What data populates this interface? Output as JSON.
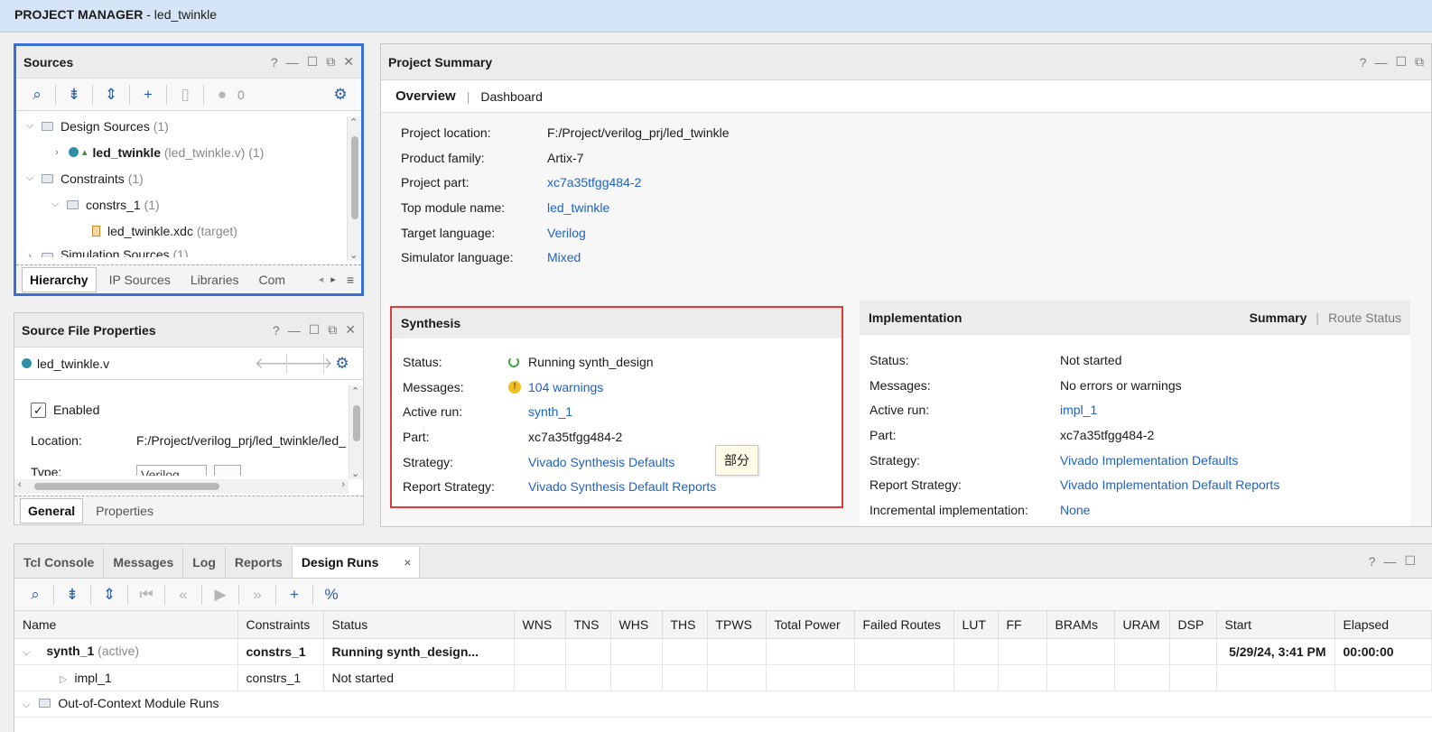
{
  "window": {
    "title_bold": "PROJECT MANAGER",
    "title_rest": " - led_twinkle"
  },
  "sources": {
    "title": "Sources",
    "help": "?",
    "counter": "0",
    "tree": [
      {
        "label": "Design Sources",
        "extra": "(1)"
      },
      {
        "label": "led_twinkle",
        "extra": "(led_twinkle.v) (1)"
      },
      {
        "label": "Constraints",
        "extra": "(1)"
      },
      {
        "label": "constrs_1",
        "extra": "(1)"
      },
      {
        "label": "led_twinkle.xdc",
        "extra": "(target)"
      },
      {
        "label": "Simulation Sources",
        "extra": "(1)"
      }
    ],
    "tabs": [
      "Hierarchy",
      "IP Sources",
      "Libraries",
      "Com"
    ]
  },
  "props": {
    "title": "Source File Properties",
    "file": "led_twinkle.v",
    "enabled_label": "Enabled",
    "location_label": "Location:",
    "location_value": "F:/Project/verilog_prj/led_twinkle/led_",
    "type_label": "Type:",
    "type_value": "Verilog",
    "tabs": [
      "General",
      "Properties"
    ]
  },
  "summary": {
    "title": "Project Summary",
    "tabs": [
      "Overview",
      "Dashboard"
    ],
    "rows": [
      {
        "k": "Project location:",
        "v": "F:/Project/verilog_prj/led_twinkle"
      },
      {
        "k": "Product family:",
        "v": "Artix-7"
      },
      {
        "k": "Project part:",
        "v": "xc7a35tfgg484-2"
      },
      {
        "k": "Top module name:",
        "v": "led_twinkle"
      },
      {
        "k": "Target language:",
        "v": "Verilog"
      },
      {
        "k": "Simulator language:",
        "v": "Mixed"
      }
    ]
  },
  "synthesis": {
    "title": "Synthesis",
    "rows": [
      {
        "k": "Status:",
        "v": "Running synth_design"
      },
      {
        "k": "Messages:",
        "v": "104 warnings"
      },
      {
        "k": "Active run:",
        "v": "synth_1"
      },
      {
        "k": "Part:",
        "v": "xc7a35tfgg484-2"
      },
      {
        "k": "Strategy:",
        "v": "Vivado Synthesis Defaults"
      },
      {
        "k": "Report Strategy:",
        "v": "Vivado Synthesis Default Reports"
      }
    ],
    "tooltip": "部分"
  },
  "implementation": {
    "title": "Implementation",
    "tabs": [
      "Summary",
      "Route Status"
    ],
    "rows": [
      {
        "k": "Status:",
        "v": "Not started"
      },
      {
        "k": "Messages:",
        "v": "No errors or warnings"
      },
      {
        "k": "Active run:",
        "v": "impl_1"
      },
      {
        "k": "Part:",
        "v": "xc7a35tfgg484-2"
      },
      {
        "k": "Strategy:",
        "v": "Vivado Implementation Defaults"
      },
      {
        "k": "Report Strategy:",
        "v": "Vivado Implementation Default Reports"
      },
      {
        "k": "Incremental implementation:",
        "v": "None"
      }
    ]
  },
  "bottom": {
    "tabs": [
      "Tcl Console",
      "Messages",
      "Log",
      "Reports",
      "Design Runs"
    ],
    "close": "×",
    "columns": [
      "Name",
      "Constraints",
      "Status",
      "WNS",
      "TNS",
      "WHS",
      "THS",
      "TPWS",
      "Total Power",
      "Failed Routes",
      "LUT",
      "FF",
      "BRAMs",
      "URAM",
      "DSP",
      "Start",
      "Elapsed"
    ],
    "runs": [
      {
        "name": "synth_1",
        "tag": "(active)",
        "constraints": "constrs_1",
        "status": "Running synth_design...",
        "start": "5/29/24, 3:41 PM",
        "elapsed": "00:00:00"
      },
      {
        "name": "impl_1",
        "tag": "",
        "constraints": "constrs_1",
        "status": "Not started",
        "start": "",
        "elapsed": ""
      }
    ],
    "ooc": "Out-of-Context Module Runs"
  },
  "colors": {
    "accent": "#2a5ea8",
    "link": "#1f62c5",
    "highlight_blue": "#3a6fd6",
    "highlight_red": "#e03b3b",
    "warn": "#f0c020"
  }
}
